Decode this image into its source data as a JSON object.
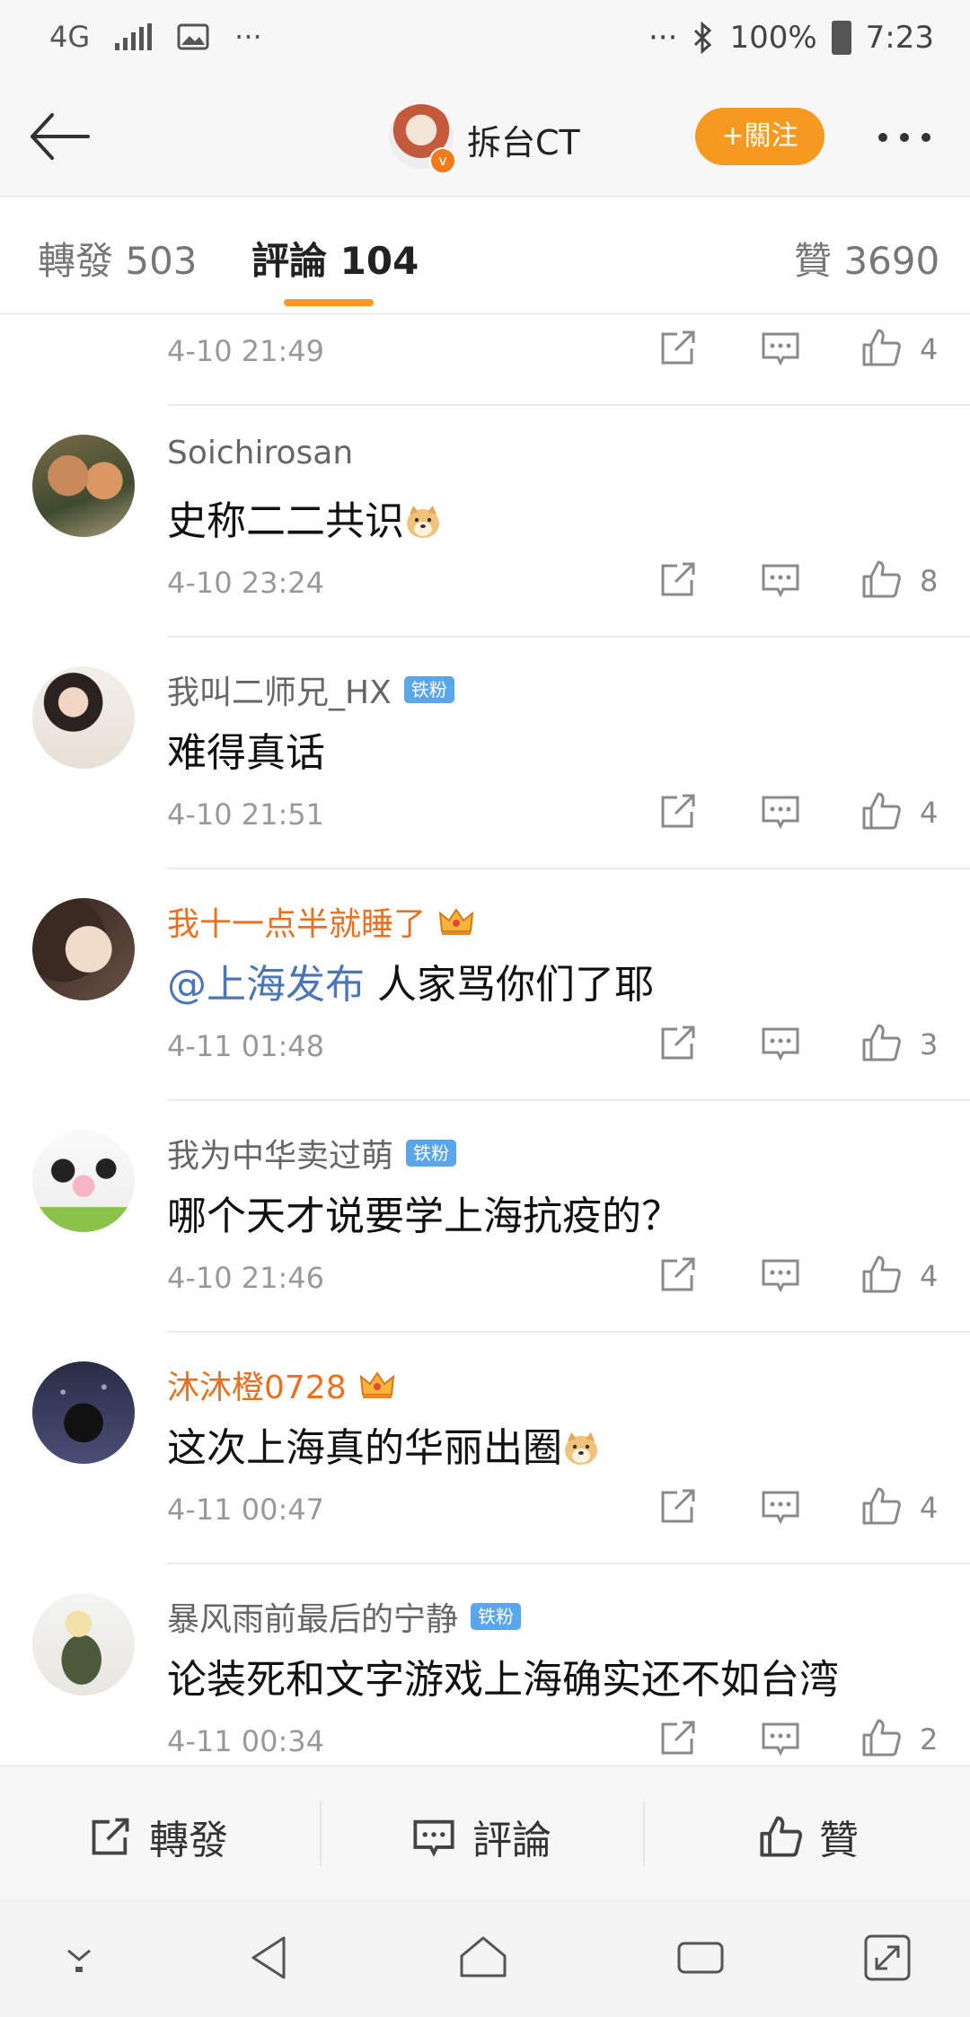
{
  "status_bar": {
    "network": "4G",
    "more": "···",
    "more_right": "···",
    "battery": "100%",
    "time": "7:23"
  },
  "header": {
    "account_name": "拆台CT",
    "follow_label": "+關注"
  },
  "tabs": [
    {
      "label": "轉發 503",
      "active": false
    },
    {
      "label": "評論 104",
      "active": true
    },
    {
      "label": "贊 3690",
      "active": false
    }
  ],
  "comments": {
    "partial": {
      "time": "4-10 21:49",
      "likes": "4"
    },
    "items": [
      {
        "user": "Soichirosan",
        "badge": "",
        "text": "史称二二共识",
        "mention": "",
        "emoji": "doge",
        "time": "4-10 23:24",
        "likes": "8"
      },
      {
        "user": "我叫二师兄_HX",
        "badge": "铁粉",
        "text": "难得真话",
        "mention": "",
        "emoji": "",
        "time": "4-10 21:51",
        "likes": "4"
      },
      {
        "user": "我十一点半就睡了",
        "badge": "crown",
        "text": "人家骂你们了耶",
        "mention": "@上海发布",
        "emoji": "",
        "time": "4-11 01:48",
        "likes": "3"
      },
      {
        "user": "我为中华卖过萌",
        "badge": "铁粉",
        "text": "哪个天才说要学上海抗疫的？",
        "mention": "",
        "emoji": "",
        "time": "4-10 21:46",
        "likes": "4"
      },
      {
        "user": "沐沐橙0728",
        "badge": "crown",
        "text": "这次上海真的华丽出圈",
        "mention": "",
        "emoji": "doge",
        "time": "4-11 00:47",
        "likes": "4"
      },
      {
        "user": "暴风雨前最后的宁静",
        "badge": "铁粉",
        "text": "论装死和文字游戏上海确实还不如台湾",
        "mention": "",
        "emoji": "",
        "time": "4-11 00:34",
        "likes": "2"
      }
    ]
  },
  "action_bar": {
    "repost": "轉發",
    "comment": "評論",
    "like": "贊"
  },
  "colors": {
    "accent": "#f59a1e",
    "vip_name": "#e8701e",
    "mention": "#4a75b6",
    "tie_badge": "#5aa6ea"
  }
}
